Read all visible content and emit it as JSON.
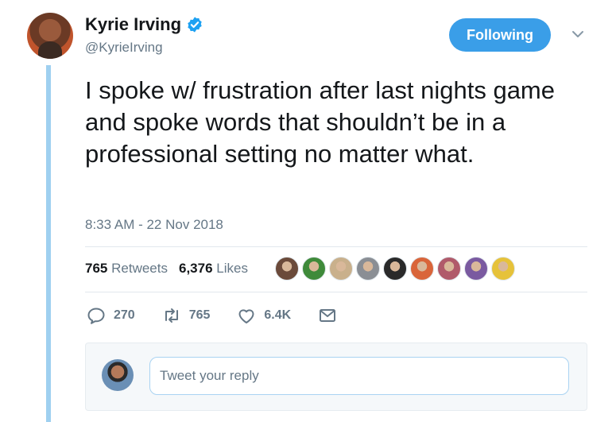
{
  "author": {
    "display_name": "Kyrie Irving",
    "handle": "@KyrieIrving",
    "verified": true
  },
  "follow_button": {
    "label": "Following",
    "color": "#3a9ee8"
  },
  "tweet": {
    "text": "I spoke w/ frustration after last nights game and spoke words that shouldn’t be in a professional setting no matter what.",
    "timestamp": "8:33 AM - 22 Nov 2018"
  },
  "stats": {
    "retweets_count": "765",
    "retweets_label": "Retweets",
    "likes_count": "6,376",
    "likes_label": "Likes"
  },
  "liker_avatars": [
    "#6b4a3a",
    "#3f8a3a",
    "#c9b08c",
    "#8a8e94",
    "#2a2a2a",
    "#d9653a",
    "#b05a6a",
    "#7a5aa0",
    "#e6c23a"
  ],
  "actions": {
    "reply": {
      "icon": "reply-icon",
      "count": "270"
    },
    "retweet": {
      "icon": "retweet-icon",
      "count": "765"
    },
    "like": {
      "icon": "heart-icon",
      "count": "6.4K"
    },
    "message": {
      "icon": "envelope-icon"
    }
  },
  "reply": {
    "placeholder": "Tweet your reply"
  },
  "colors": {
    "thread_line": "#9fd0f0",
    "secondary_text": "#657786",
    "accent": "#1da1f2"
  }
}
